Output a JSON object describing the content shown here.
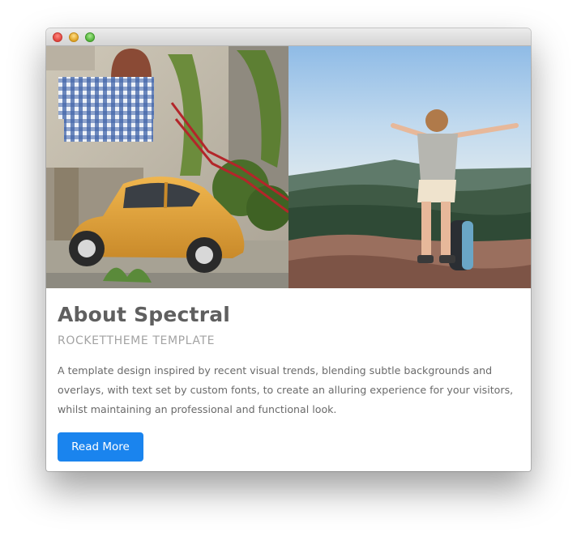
{
  "article": {
    "title": "About Spectral",
    "subtitle": "ROCKETTHEME TEMPLATE",
    "description": "A template design inspired by recent visual trends, blending subtle backgrounds and overlays, with text set by custom fonts, to create an alluring experience for your visitors, whilst maintaining an professional and functional look.",
    "button_label": "Read More"
  },
  "colors": {
    "accent": "#1a84ee",
    "title": "#5f5f5f",
    "subtitle": "#a3a3a3",
    "body_text": "#6a6a6a"
  },
  "icons": [
    "close-window-icon",
    "minimize-window-icon",
    "maximize-window-icon"
  ]
}
